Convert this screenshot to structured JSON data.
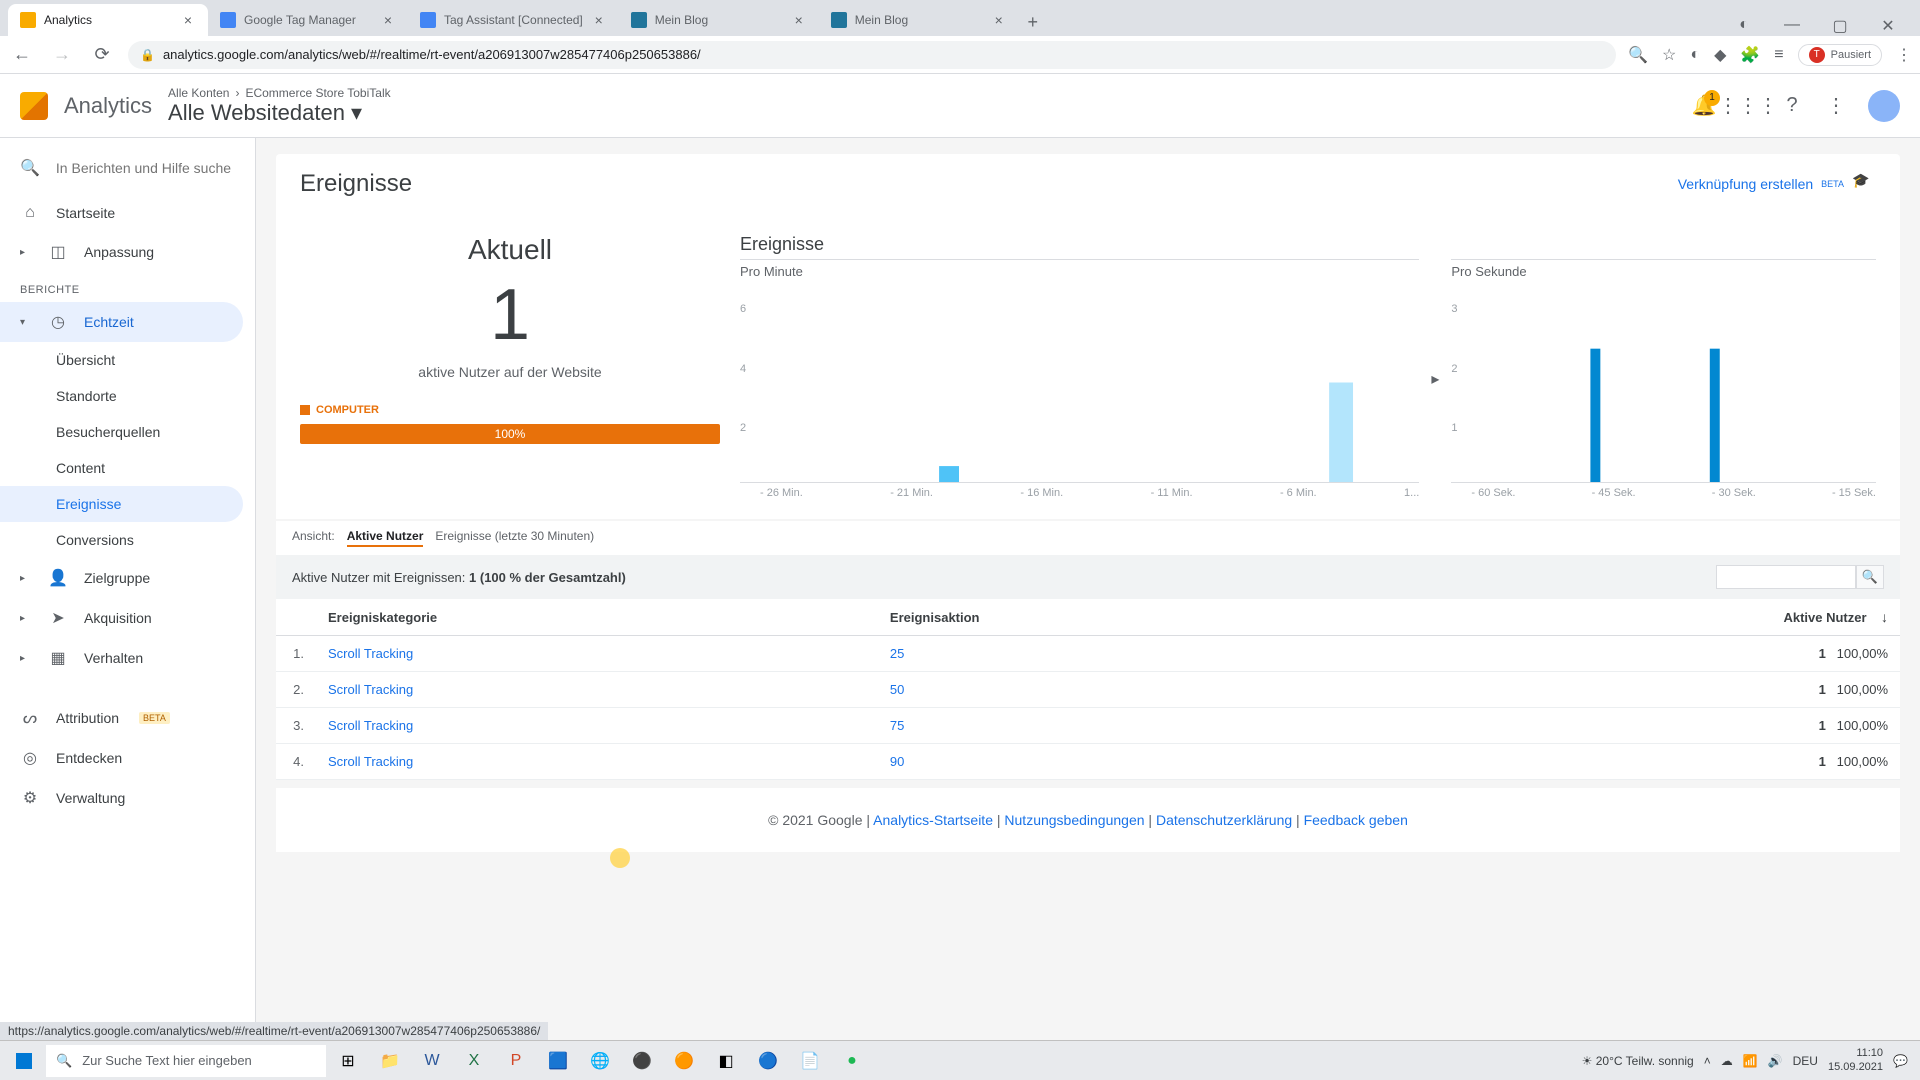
{
  "browser": {
    "tabs": [
      {
        "title": "Analytics",
        "active": true
      },
      {
        "title": "Google Tag Manager"
      },
      {
        "title": "Tag Assistant [Connected]"
      },
      {
        "title": "Mein Blog"
      },
      {
        "title": "Mein Blog"
      }
    ],
    "url": "analytics.google.com/analytics/web/#/realtime/rt-event/a206913007w285477406p250653886/",
    "pause_label": "Pausiert"
  },
  "ga_header": {
    "product": "Analytics",
    "breadcrumb_parent": "Alle Konten",
    "breadcrumb_account": "ECommerce Store TobiTalk",
    "view": "Alle Websitedaten",
    "bell_count": "1"
  },
  "sidebar": {
    "search_placeholder": "In Berichten und Hilfe suche",
    "home": "Startseite",
    "customization": "Anpassung",
    "reports_label": "BERICHTE",
    "realtime": "Echtzeit",
    "realtime_items": [
      "Übersicht",
      "Standorte",
      "Besucherquellen",
      "Content",
      "Ereignisse",
      "Conversions"
    ],
    "audience": "Zielgruppe",
    "acquisition": "Akquisition",
    "behavior": "Verhalten",
    "attribution": "Attribution",
    "attribution_beta": "BETA",
    "discover": "Entdecken",
    "admin": "Verwaltung"
  },
  "page": {
    "title": "Ereignisse",
    "create_link": "Verknüpfung erstellen",
    "create_beta": "BETA"
  },
  "aktuell": {
    "label": "Aktuell",
    "count": "1",
    "subtitle": "aktive Nutzer auf der Website",
    "device": "COMPUTER",
    "device_pct": "100%"
  },
  "charts": {
    "title": "Ereignisse",
    "per_minute": "Pro Minute",
    "per_second": "Pro Sekunde"
  },
  "chart_data": [
    {
      "type": "bar",
      "title": "Pro Minute",
      "ylabel": "",
      "ylim": [
        0,
        6
      ],
      "y_ticks": [
        2,
        4,
        6
      ],
      "categories": [
        "- 26 Min.",
        "- 21 Min.",
        "- 16 Min.",
        "- 11 Min.",
        "- 6 Min.",
        "1..."
      ],
      "values_by_minute": {
        "-21": 1,
        "-1": 3
      }
    },
    {
      "type": "bar",
      "title": "Pro Sekunde",
      "ylabel": "",
      "ylim": [
        0,
        3
      ],
      "y_ticks": [
        1,
        2,
        3
      ],
      "categories": [
        "- 60 Sek.",
        "- 45 Sek.",
        "- 30 Sek.",
        "- 15 Sek."
      ],
      "values_by_second": {
        "-45": 2,
        "-30": 2
      }
    }
  ],
  "table": {
    "view_label": "Ansicht:",
    "tab_active": "Aktive Nutzer",
    "tab_events": "Ereignisse (letzte 30 Minuten)",
    "summary_prefix": "Aktive Nutzer mit Ereignissen:",
    "summary_value": "1 (100 % der Gesamtzahl)",
    "col_category": "Ereigniskategorie",
    "col_action": "Ereignisaktion",
    "col_users": "Aktive Nutzer",
    "rows": [
      {
        "idx": "1.",
        "category": "Scroll Tracking",
        "action": "25",
        "users": "1",
        "pct": "100,00%"
      },
      {
        "idx": "2.",
        "category": "Scroll Tracking",
        "action": "50",
        "users": "1",
        "pct": "100,00%"
      },
      {
        "idx": "3.",
        "category": "Scroll Tracking",
        "action": "75",
        "users": "1",
        "pct": "100,00%"
      },
      {
        "idx": "4.",
        "category": "Scroll Tracking",
        "action": "90",
        "users": "1",
        "pct": "100,00%"
      }
    ]
  },
  "footer": {
    "copyright": "© 2021 Google",
    "links": [
      "Analytics-Startseite",
      "Nutzungsbedingungen",
      "Datenschutzerklärung",
      "Feedback geben"
    ]
  },
  "status_url": "https://analytics.google.com/analytics/web/#/realtime/rt-event/a206913007w285477406p250653886/",
  "taskbar": {
    "search_placeholder": "Zur Suche Text hier eingeben",
    "weather": "20°C  Teilw. sonnig",
    "lang": "DEU",
    "time": "11:10",
    "date": "15.09.2021"
  }
}
